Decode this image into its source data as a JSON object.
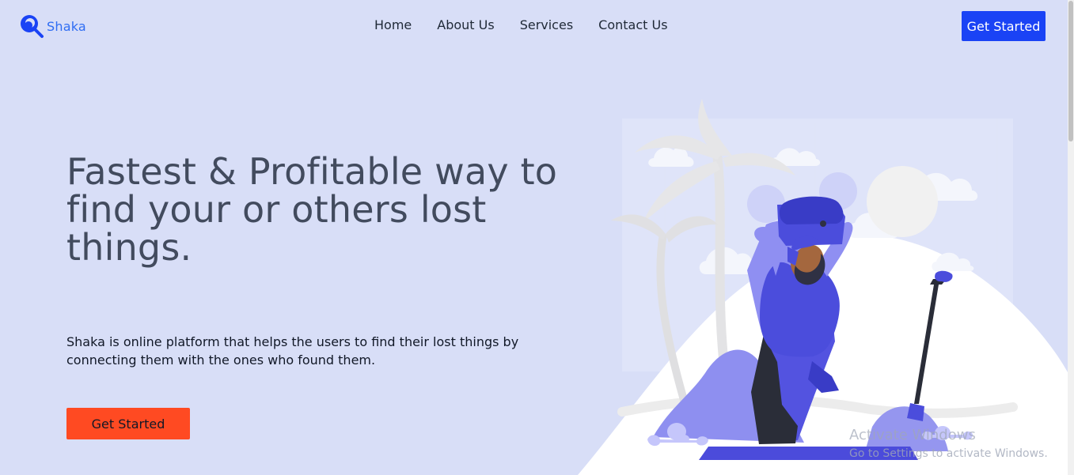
{
  "brand": {
    "name": "Shaka",
    "logo_icon": "search-magnifier-icon",
    "color": "#2f6df3"
  },
  "nav": {
    "items": [
      {
        "label": "Home"
      },
      {
        "label": "About Us"
      },
      {
        "label": "Services"
      },
      {
        "label": "Contact Us"
      }
    ],
    "cta_label": "Get Started",
    "cta_color": "#1a43f5"
  },
  "hero": {
    "title": "Fastest & Profitable way to find your or others lost things.",
    "description": "Shaka is online platform that helps the users to find their lost things by connecting them with the ones who found them.",
    "cta_label": "Get Started",
    "cta_color": "#ff4a22",
    "illustration": "treasure-hunter-holding-chest-illustration"
  },
  "watermark": {
    "title": "Activate Windows",
    "subtitle": "Go to Settings to activate Windows."
  },
  "colors": {
    "background": "#d8def7",
    "heading": "#424b5e",
    "text": "#111827"
  }
}
